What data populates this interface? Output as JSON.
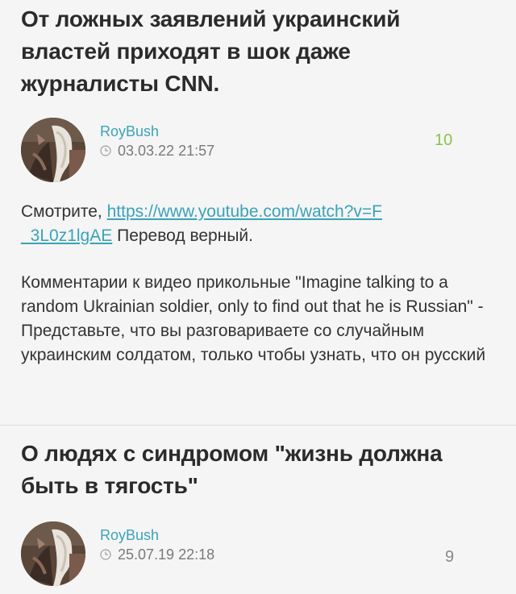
{
  "posts": [
    {
      "title": "От ложных заявлений украинский властей приходят в шок даже журналисты CNN.",
      "author": "RoyBush",
      "date": "03.03.22 21:57",
      "score": "10",
      "score_color": "#8bc34a",
      "body": {
        "intro": "Смотрите, ",
        "link_line1": "https://www.youtube.com/watch?v=F",
        "link_line2": "_3L0z1lgAE",
        "after_link": " Перевод верный.",
        "paragraph2": "Комментарии к видео прикольные \"Imagine talking to a random Ukrainian soldier, only to find out that he is Russian\" - Представьте, что вы разговариваете со случайным украинским солдатом, только чтобы узнать, что он русский"
      }
    },
    {
      "title": "О людях с синдромом \"жизнь должна быть в тягость\"",
      "author": "RoyBush",
      "date": "25.07.19 22:18",
      "score": "9",
      "score_color": "#888888"
    }
  ],
  "icons": {
    "date": "clock-icon",
    "avatar": "avatar-image"
  }
}
